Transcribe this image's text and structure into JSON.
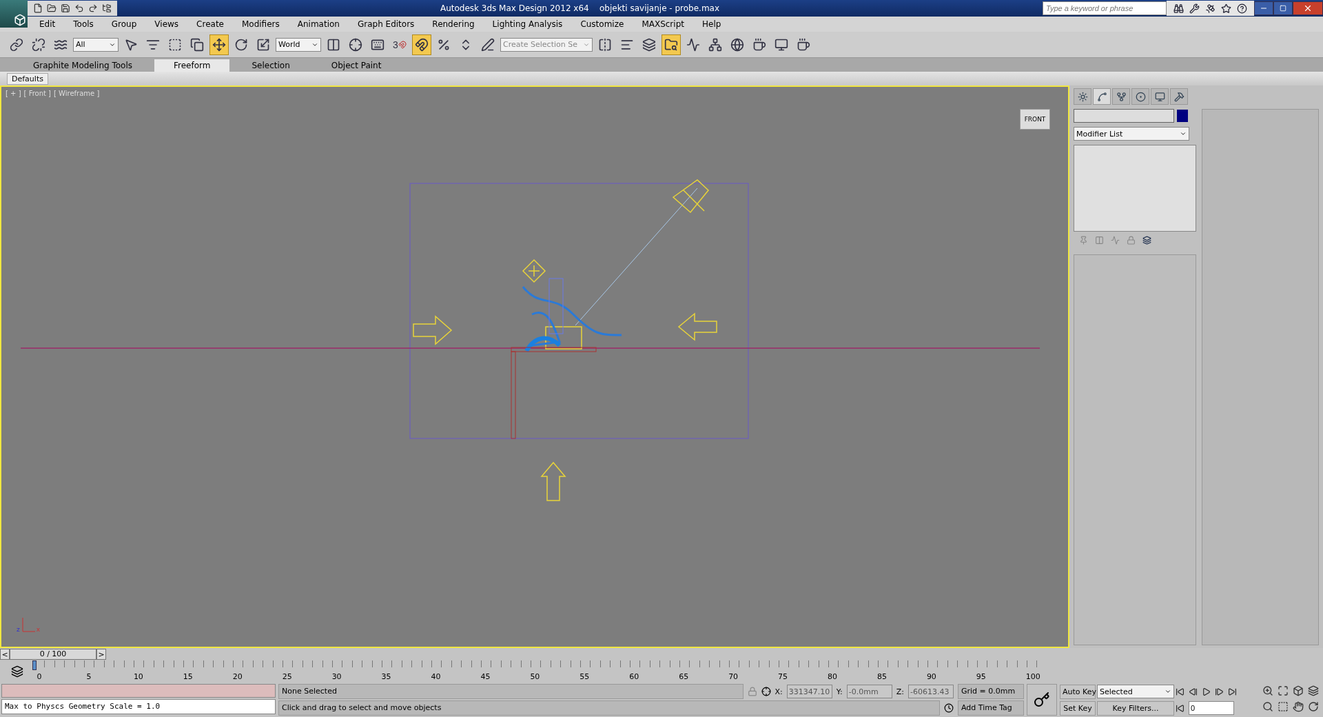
{
  "title_bar": {
    "app": "Autodesk 3ds Max Design 2012 x64",
    "file": "objekti savijanje - probe.max",
    "search": {
      "placeholder": "Type a keyword or phrase"
    }
  },
  "menu": [
    "Edit",
    "Tools",
    "Group",
    "Views",
    "Create",
    "Modifiers",
    "Animation",
    "Graph Editors",
    "Rendering",
    "Lighting Analysis",
    "Customize",
    "MAXScript",
    "Help"
  ],
  "toolbar": [
    {
      "kind": "button",
      "active": false
    },
    {
      "kind": "button",
      "active": false
    },
    {
      "kind": "button",
      "active": false
    },
    {
      "kind": "dropdown",
      "value": "All"
    },
    {
      "kind": "button",
      "active": false
    },
    {
      "kind": "button",
      "active": false
    },
    {
      "kind": "button",
      "active": false
    },
    {
      "kind": "button",
      "active": false
    },
    {
      "kind": "button",
      "active": true
    },
    {
      "kind": "button",
      "active": false
    },
    {
      "kind": "button",
      "active": false
    },
    {
      "kind": "dropdown",
      "value": "World"
    },
    {
      "kind": "button",
      "active": false
    },
    {
      "kind": "button",
      "active": false
    },
    {
      "kind": "button",
      "active": false
    },
    {
      "kind": "snap",
      "label": "3",
      "active": false
    },
    {
      "kind": "button",
      "active": true
    },
    {
      "kind": "button",
      "active": false
    },
    {
      "kind": "button",
      "active": false
    },
    {
      "kind": "button",
      "active": false
    },
    {
      "kind": "dropdown",
      "value": "Create Selection Se"
    },
    {
      "kind": "button",
      "active": false
    },
    {
      "kind": "button",
      "active": false
    },
    {
      "kind": "button",
      "active": false
    },
    {
      "kind": "button",
      "active": true
    },
    {
      "kind": "button",
      "active": false
    },
    {
      "kind": "button",
      "active": false
    },
    {
      "kind": "button",
      "active": false
    },
    {
      "kind": "button",
      "active": false
    },
    {
      "kind": "button",
      "active": false
    },
    {
      "kind": "button",
      "active": false
    }
  ],
  "ribbon": {
    "tabs": [
      {
        "label": "Graphite Modeling Tools",
        "selected": false
      },
      {
        "label": "Freeform",
        "selected": true
      },
      {
        "label": "Selection",
        "selected": false
      },
      {
        "label": "Object Paint",
        "selected": false
      }
    ],
    "defaults": "Defaults"
  },
  "viewport": {
    "labels": [
      "[ + ]",
      "[ Front ]",
      "[ Wireframe ]"
    ],
    "viewcube": "FRONT",
    "axis": [
      "z",
      "x"
    ]
  },
  "command_panel": {
    "tabs": [
      {
        "selected": false
      },
      {
        "selected": true
      },
      {
        "selected": false
      },
      {
        "selected": false
      },
      {
        "selected": false
      },
      {
        "selected": false
      }
    ],
    "color": "#000080",
    "modifier_list": "Modifier List"
  },
  "time_slider": {
    "level": 0,
    "prev": "<",
    "position": "0 / 100",
    "next": ">"
  },
  "track_bar": {
    "ticks": [
      "0",
      "5",
      "10",
      "15",
      "20",
      "25",
      "30",
      "35",
      "40",
      "45",
      "50",
      "55",
      "60",
      "65",
      "70",
      "75",
      "80",
      "85",
      "90",
      "95",
      "100"
    ]
  },
  "listener": {
    "output": "Max to Physcs Geometry Scale = 1.0"
  },
  "status": {
    "selection": "None Selected",
    "prompt": "Click and drag to select and move objects",
    "coords": [
      {
        "label": "X:",
        "value": "331347.10"
      },
      {
        "label": "Y:",
        "value": "-0.0mm"
      },
      {
        "label": "Z:",
        "value": "-60613.43"
      }
    ],
    "grid": "Grid = 0.0mm",
    "time_tag": "Add Time Tag"
  },
  "animation": {
    "auto_key": "Auto Key",
    "set_key": "Set Key",
    "key_mode": "Selected",
    "key_filters": "Key Filters...",
    "frame": "0"
  }
}
